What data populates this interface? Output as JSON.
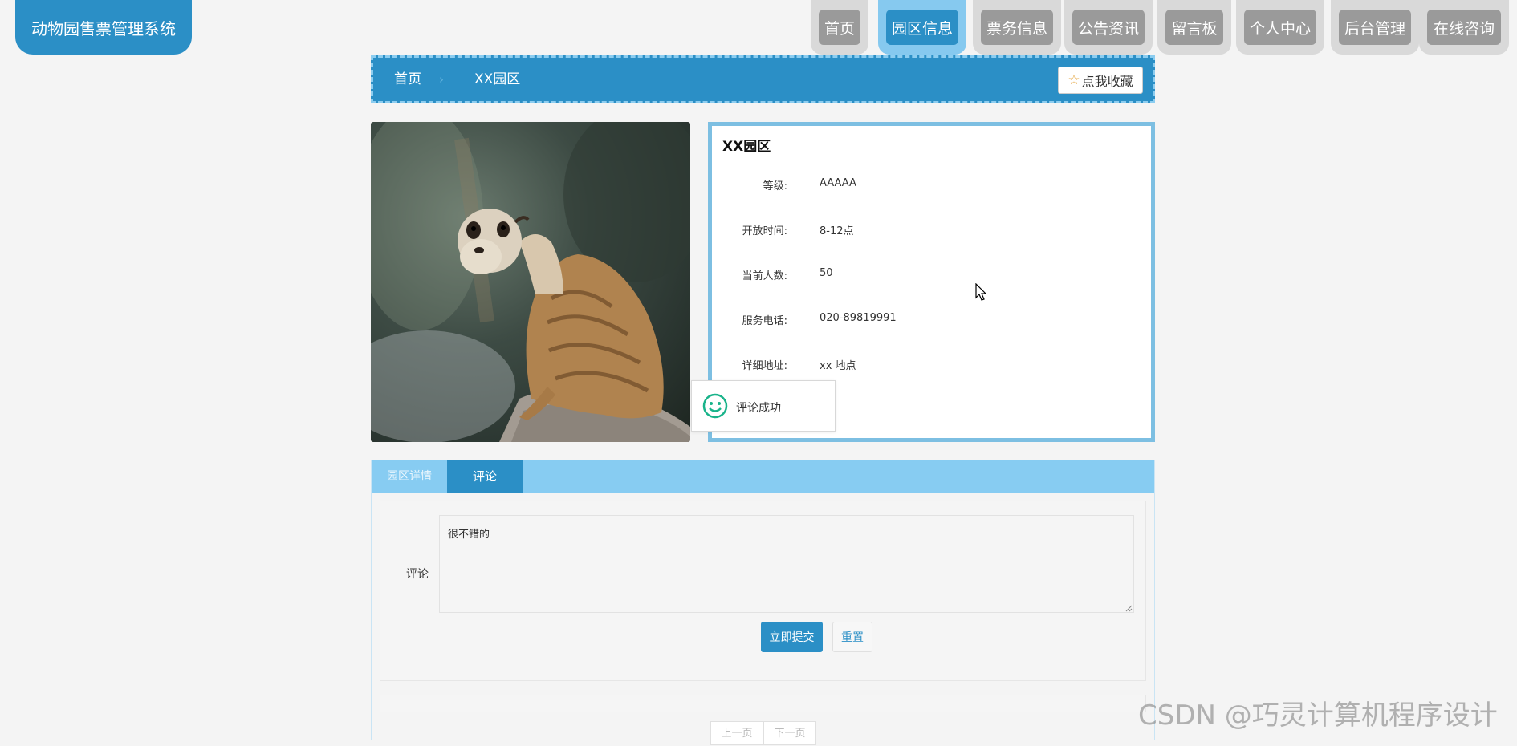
{
  "app": {
    "title": "动物园售票管理系统"
  },
  "nav": {
    "items": [
      {
        "label": "首页",
        "active": false
      },
      {
        "label": "园区信息",
        "active": true
      },
      {
        "label": "票务信息",
        "active": false
      },
      {
        "label": "公告资讯",
        "active": false
      },
      {
        "label": "留言板",
        "active": false
      },
      {
        "label": "个人中心",
        "active": false
      },
      {
        "label": "后台管理",
        "active": false
      },
      {
        "label": "在线咨询",
        "active": false
      }
    ]
  },
  "breadcrumb": {
    "home": "首页",
    "separator": "›",
    "current": "XX园区",
    "favorite_label": "点我收藏",
    "favorite_icon": "star-outline-icon"
  },
  "park": {
    "name": "XX园区",
    "photo_subject": "meerkat",
    "fields": [
      {
        "label": "等级:",
        "value": "AAAAA"
      },
      {
        "label": "开放时间:",
        "value": "8-12点"
      },
      {
        "label": "当前人数:",
        "value": "50"
      },
      {
        "label": "服务电话:",
        "value": "020-89819991"
      },
      {
        "label": "详细地址:",
        "value": "xx 地点"
      }
    ]
  },
  "toast": {
    "icon": "smile-icon",
    "message": "评论成功"
  },
  "tabs": [
    {
      "label": "园区详情",
      "active": false
    },
    {
      "label": "评论",
      "active": true
    }
  ],
  "comment_form": {
    "label": "评论",
    "value": "很不错的",
    "submit_label": "立即提交",
    "reset_label": "重置"
  },
  "pagination": {
    "prev_label": "上一页",
    "next_label": "下一页"
  },
  "watermark": "CSDN @巧灵计算机程序设计",
  "colors": {
    "primary": "#2b8fc6",
    "accent_light": "#87ccf2",
    "toast_icon": "#19b38a"
  }
}
